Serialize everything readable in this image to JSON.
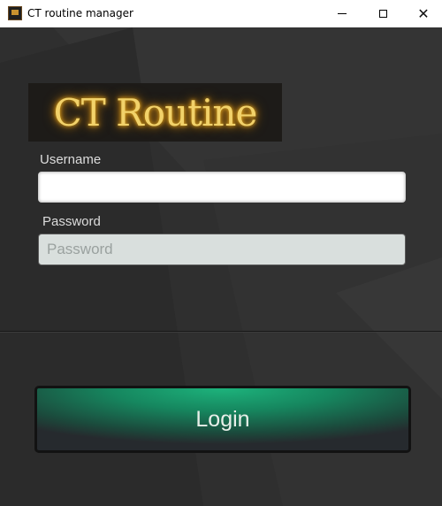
{
  "window": {
    "title": "CT routine manager",
    "icons": {
      "app": "app-icon",
      "minimize": "minimize-icon",
      "maximize": "maximize-icon",
      "close": "close-icon"
    }
  },
  "logo": {
    "text": "CT Routine",
    "glow_color": "#e6a91c"
  },
  "form": {
    "username_label": "Username",
    "username_value": "",
    "password_label": "Password",
    "password_value": "",
    "password_placeholder": "Password"
  },
  "actions": {
    "login_label": "Login"
  },
  "colors": {
    "background": "#2f2f2f",
    "button_green": "#1db37c"
  }
}
